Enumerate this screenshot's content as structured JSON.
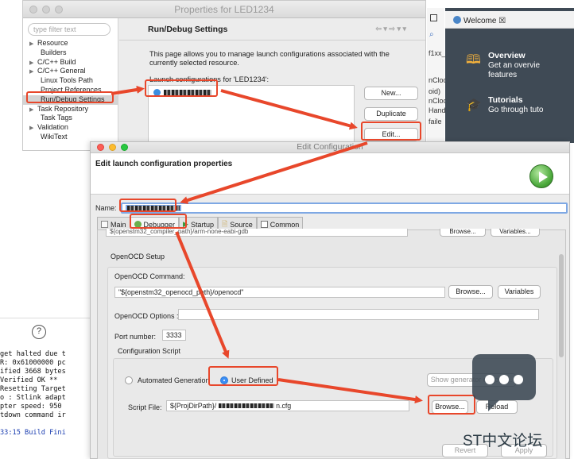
{
  "properties_window": {
    "title": "Properties for LED1234",
    "filter_placeholder": "type filter text",
    "tree": [
      {
        "label": "Resource",
        "arrow": "▶",
        "sub": false
      },
      {
        "label": "Builders",
        "arrow": "",
        "sub": true
      },
      {
        "label": "C/C++ Build",
        "arrow": "▶",
        "sub": false
      },
      {
        "label": "C/C++ General",
        "arrow": "▶",
        "sub": false
      },
      {
        "label": "Linux Tools Path",
        "arrow": "",
        "sub": true
      },
      {
        "label": "Project References",
        "arrow": "",
        "sub": true
      },
      {
        "label": "Run/Debug Settings",
        "arrow": "",
        "sub": true,
        "selected": true
      },
      {
        "label": "Task Repository",
        "arrow": "▶",
        "sub": false
      },
      {
        "label": "Task Tags",
        "arrow": "",
        "sub": true
      },
      {
        "label": "Validation",
        "arrow": "▶",
        "sub": false
      },
      {
        "label": "WikiText",
        "arrow": "",
        "sub": true
      }
    ],
    "header": "Run/Debug Settings",
    "description": "This page allows you to manage launch configurations associated with the currently selected resource.",
    "list_label": "Launch configurations for 'LED1234':",
    "buttons": {
      "new": "New...",
      "duplicate": "Duplicate",
      "edit": "Edit..."
    }
  },
  "middle_strip": [
    "f1xx_",
    "nCloc",
    "oid)",
    "nCloc",
    "Hand",
    "faile"
  ],
  "welcome": {
    "tab": "Welcome ☒",
    "overview_title": "Overview",
    "overview_lines": [
      "Get an overvie",
      "features"
    ],
    "tutorials_title": "Tutorials",
    "tutorials_lines": [
      "Go through tuto"
    ]
  },
  "console": {
    "lines": [
      "get halted due t",
      "R: 0x61000000 pc",
      "ified 3668 bytes",
      "Verified OK **",
      "Resetting Target",
      "o : Stlink adapt",
      "pter speed: 950",
      "tdown command ir",
      "",
      "33:15 Build Fini"
    ]
  },
  "edit_config": {
    "title": "Edit Configuration",
    "header": "Edit launch configuration properties",
    "name_label": "Name:",
    "tabs": [
      "Main",
      "Debugger",
      "Startup",
      "Source",
      "Common"
    ],
    "active_tab": "Debugger",
    "partial_top_text": "${openstm32_compiler_path}/arm-none-eabi-gdb",
    "partial_browse": "Browse...",
    "partial_variables": "Variables...",
    "openocd_setup_label": "OpenOCD Setup",
    "openocd_command_label": "OpenOCD Command:",
    "openocd_command_value": "\"${openstm32_openocd_path}/openocd\"",
    "browse_label": "Browse...",
    "variables_label": "Variables",
    "openocd_options_label": "OpenOCD Options :",
    "port_label": "Port number:",
    "port_value": "3333",
    "config_script_label": "Configuration Script",
    "automated_label": "Automated Generation",
    "user_defined_label": "User Defined",
    "show_generator_label": "Show generator options...",
    "script_file_label": "Script File:",
    "script_file_value": "${ProjDirPath}/",
    "script_file_suffix": "n.cfg",
    "script_browse_label": "Browse...",
    "reload_label": "Reload",
    "revert_label": "Revert",
    "apply_label": "Apply"
  },
  "watermark": "ST中文论坛",
  "colors": {
    "highlight": "#e8472b",
    "selection": "#7ea8e4",
    "welcome_bg": "#3f4a55",
    "accent_radio": "#3a8ef5"
  }
}
